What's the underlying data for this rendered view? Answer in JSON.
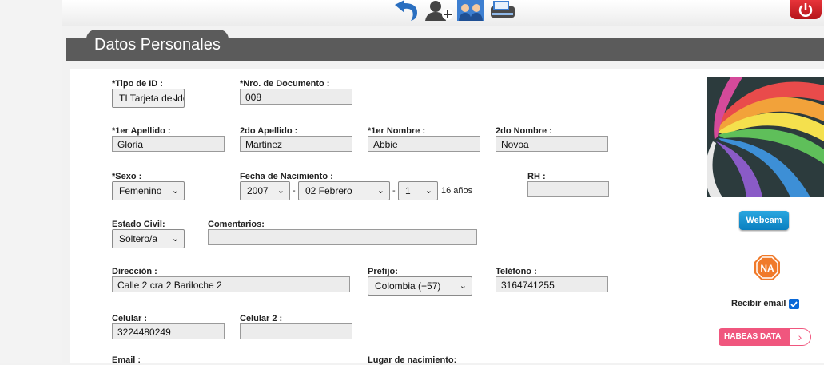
{
  "header": {
    "title": "Datos Personales"
  },
  "fields": {
    "tipo_id": {
      "label": "*Tipo de ID :",
      "value": "TI Tarjeta de Identidad"
    },
    "nro_documento": {
      "label": "*Nro. de Documento :",
      "value": "008"
    },
    "apellido1": {
      "label": "*1er Apellido :",
      "value": "Gloria"
    },
    "apellido2": {
      "label": "2do Apellido :",
      "value": "Martinez"
    },
    "nombre1": {
      "label": "*1er Nombre :",
      "value": "Abbie"
    },
    "nombre2": {
      "label": "2do Nombre :",
      "value": "Novoa"
    },
    "sexo": {
      "label": "*Sexo :",
      "value": "Femenino"
    },
    "fecha_nacimiento": {
      "label": "Fecha de Nacimiento :",
      "year": "2007",
      "month": "02 Febrero",
      "day": "1",
      "sep": "-",
      "age": "16 años"
    },
    "rh": {
      "label": "RH :",
      "value": ""
    },
    "estado_civil": {
      "label": "Estado Civil:",
      "value": "Soltero/a"
    },
    "comentarios": {
      "label": "Comentarios:",
      "value": ""
    },
    "direccion": {
      "label": "Dirección :",
      "value": "Calle 2 cra 2 Bariloche 2"
    },
    "prefijo": {
      "label": "Prefijo:",
      "value": "Colombia (+57)"
    },
    "telefono": {
      "label": "Teléfono :",
      "value": "3164741255"
    },
    "celular": {
      "label": "Celular :",
      "value": "3224480249"
    },
    "celular2": {
      "label": "Celular 2 :",
      "value": ""
    },
    "email": {
      "label": "Email :"
    },
    "lugar_nacimiento": {
      "label": "Lugar de nacimiento:"
    }
  },
  "sidebar": {
    "webcam_label": "Webcam",
    "na_label": "NA",
    "recibir_email_label": "Recibir email",
    "habeas_label": "HABEAS DATA",
    "habeas_arrow": "›"
  },
  "icons": {
    "chevron": "⌄"
  },
  "colors": {
    "header": "#5b5b5b",
    "webcam": "#1a93d3",
    "habeas": "#f0567e",
    "na": "#f07a2a",
    "power": "#d9232a"
  }
}
